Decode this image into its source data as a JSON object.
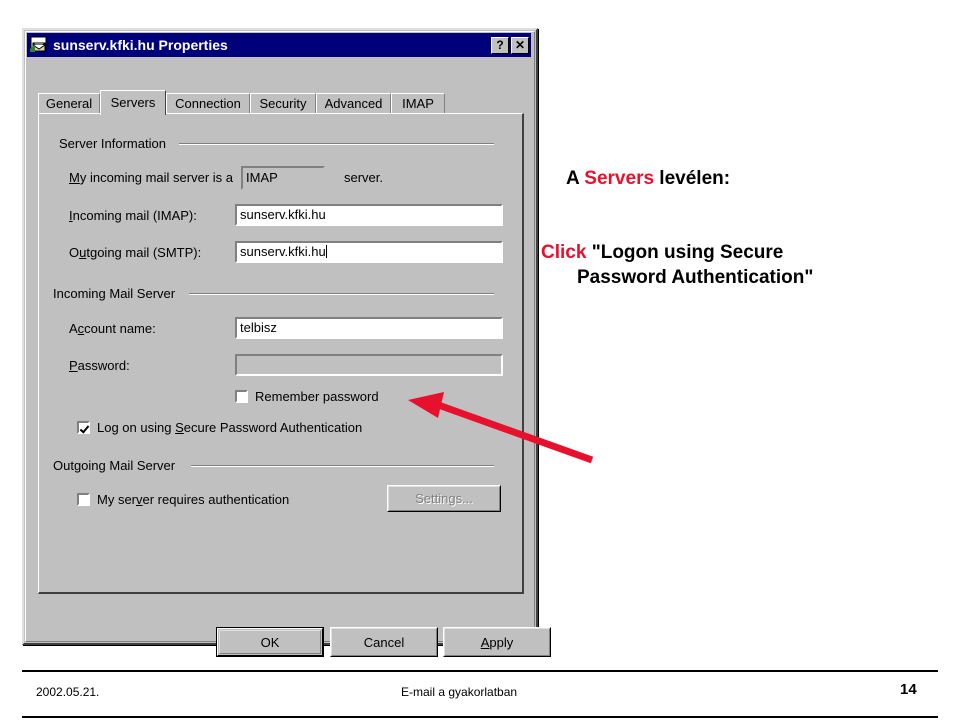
{
  "slide": {
    "annotation_line1_prefix": "A ",
    "annotation_line1_highlight": "Servers",
    "annotation_line1_suffix": " levélen:",
    "annotation_line2_highlight": "Click",
    "annotation_line2_rest": " \"Logon using Secure",
    "annotation_line2_cont": "Password Authentication\"",
    "highlight_color": "#e8112d"
  },
  "footer": {
    "date": "2002.05.21.",
    "title": "E-mail a gyakorlatban",
    "page_number": "14"
  },
  "dialog": {
    "title": "sunserv.kfki.hu Properties",
    "icon": "mail-envelope-icon",
    "titlebar_color": "#00007b",
    "help_button": "?",
    "close_button": "✕",
    "tabs": [
      {
        "label": "General",
        "active": false
      },
      {
        "label": "Servers",
        "active": true
      },
      {
        "label": "Connection",
        "active": false
      },
      {
        "label": "Security",
        "active": false
      },
      {
        "label": "Advanced",
        "active": false
      },
      {
        "label": "IMAP",
        "active": false
      }
    ],
    "groups": {
      "server_information": "Server Information",
      "incoming_mail_server": "Incoming Mail Server",
      "outgoing_mail_server": "Outgoing Mail Server"
    },
    "server_info": {
      "incoming_type_label_pre": "M",
      "incoming_type_label_post": "y incoming mail server is a",
      "incoming_type_value": "IMAP",
      "incoming_type_suffix": "server.",
      "incoming_mail_label_pre": "I",
      "incoming_mail_label_post": "ncoming mail (IMAP):",
      "incoming_mail_value": "sunserv.kfki.hu",
      "outgoing_mail_label_pre": "O",
      "outgoing_mail_label_mid": "u",
      "outgoing_mail_label_post": "tgoing mail (SMTP):",
      "outgoing_mail_value": "sunserv.kfki.hu"
    },
    "incoming": {
      "account_label_pre": "A",
      "account_label_mid": "c",
      "account_label_post": "count name:",
      "account_value": "telbisz",
      "password_label_pre": "P",
      "password_label_post": "assword:",
      "password_value": "",
      "remember_password_label": "Remember password",
      "remember_password_checked": false,
      "spa_label_a": "Log on using ",
      "spa_label_b": "S",
      "spa_label_c": "ecure Password Authentication",
      "spa_checked": true
    },
    "outgoing": {
      "requires_auth_label_a": "My ser",
      "requires_auth_label_b": "v",
      "requires_auth_label_c": "er requires authentication",
      "requires_auth_checked": false,
      "settings_button": "Settings...",
      "settings_disabled": true
    },
    "buttons": {
      "ok": "OK",
      "cancel": "Cancel",
      "apply_pre": "A",
      "apply_post": "pply"
    }
  }
}
